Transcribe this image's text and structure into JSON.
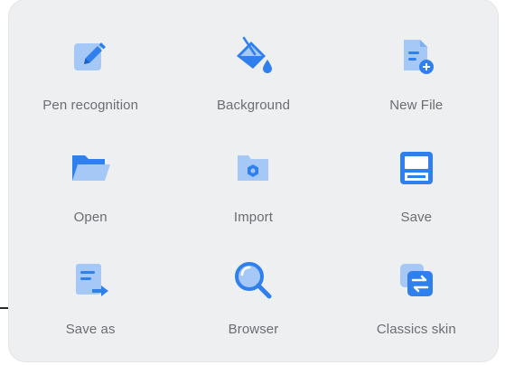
{
  "menu": {
    "items": [
      {
        "label": "Pen recognition",
        "icon": "pen-edit-icon"
      },
      {
        "label": "Background",
        "icon": "paint-bucket-icon"
      },
      {
        "label": "New File",
        "icon": "new-file-icon"
      },
      {
        "label": "Open",
        "icon": "folder-open-icon"
      },
      {
        "label": "Import",
        "icon": "import-folder-icon"
      },
      {
        "label": "Save",
        "icon": "save-floppy-icon"
      },
      {
        "label": "Save as",
        "icon": "save-as-icon"
      },
      {
        "label": "Browser",
        "icon": "magnifier-icon"
      },
      {
        "label": "Classics skin",
        "icon": "swap-skin-icon"
      }
    ]
  },
  "colors": {
    "primary_blue": "#2f80ed",
    "light_blue": "#a6c8f6",
    "panel_bg": "#eeeff1",
    "label_gray": "#6b6d72"
  }
}
